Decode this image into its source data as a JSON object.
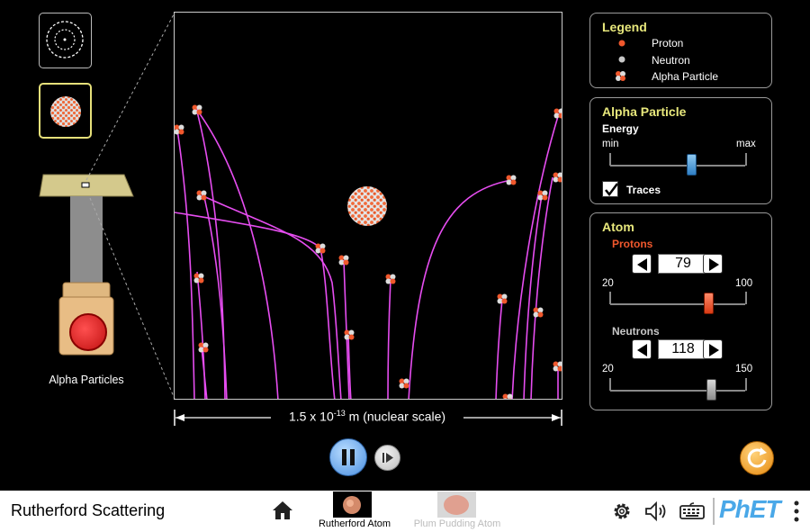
{
  "sim_title": "Rutherford Scattering",
  "screens": [
    {
      "label": "Rutherford Atom",
      "selected": true
    },
    {
      "label": "Plum Pudding Atom",
      "selected": false
    }
  ],
  "gun": {
    "label": "Alpha Particles"
  },
  "scale": {
    "base": "1.5 x 10",
    "exponent": "-13",
    "unit": " m (nuclear scale)"
  },
  "legend": {
    "title": "Legend",
    "items": [
      {
        "label": "Proton",
        "icon": "proton-icon",
        "color": "#f0582d"
      },
      {
        "label": "Neutron",
        "icon": "neutron-icon",
        "color": "#c8c8c8"
      },
      {
        "label": "Alpha Particle",
        "icon": "alpha-particle-icon"
      }
    ]
  },
  "alpha_panel": {
    "title": "Alpha Particle",
    "energy_label": "Energy",
    "min_label": "min",
    "max_label": "max",
    "energy_fraction": 0.6,
    "traces_label": "Traces",
    "traces_checked": true
  },
  "atom_panel": {
    "title": "Atom",
    "protons": {
      "label": "Protons",
      "value": "79",
      "min": "20",
      "max": "100",
      "color": "#f0582d"
    },
    "neutrons": {
      "label": "Neutrons",
      "value": "118",
      "min": "20",
      "max": "150",
      "color": "#c8c8c8"
    }
  },
  "colors": {
    "trace": "#e64df0",
    "accent_yellow": "#e8e87c",
    "play_blue": "#5aa0e8",
    "reset_orange": "#f0a020"
  },
  "icons": [
    "home-icon",
    "settings-icon",
    "sound-icon",
    "keyboard-icon",
    "phet-logo",
    "more-options-icon",
    "pause-icon",
    "step-forward-icon",
    "reset-all-icon"
  ],
  "brand": "PhET"
}
